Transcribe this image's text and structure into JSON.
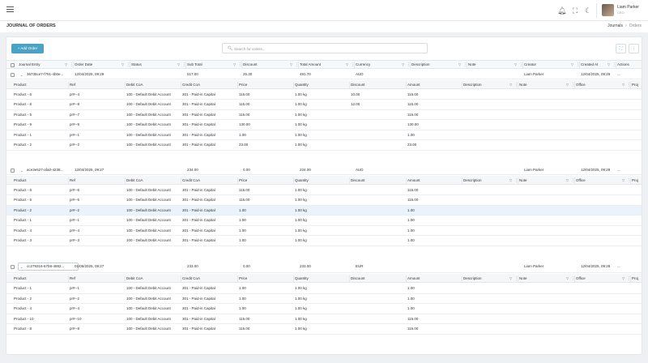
{
  "header": {
    "icons": [
      "menu-icon",
      "bell-icon",
      "fullscreen-icon",
      "moon-icon"
    ],
    "user": {
      "name": "Liam Parker",
      "role": "CEO"
    }
  },
  "page": {
    "title": "JOURNAL OF ORDERS",
    "breadcrumb": [
      "Journals",
      "Orders"
    ]
  },
  "toolbar": {
    "add_label": "+ Add Order",
    "search_placeholder": "Search for orders..."
  },
  "main_columns": [
    "Journal Entry",
    "Order Date",
    "Status",
    "Sub Total",
    "Discount",
    "Total Amount",
    "Currency",
    "Description",
    "Note",
    "Creator",
    "Created At",
    "Actions"
  ],
  "sub_columns": [
    "Product",
    "Ref",
    "Debit CoA",
    "Credit CoA",
    "Price",
    "Quantity",
    "Discount",
    "Amount",
    "Description",
    "Note",
    "Office",
    "Proj"
  ],
  "orders": [
    {
      "id": "36735ce7-f791-4b0e...",
      "date": "12/04/2025, 09:29",
      "status": "",
      "subtotal": "517.00",
      "discount": "25.30",
      "total": "491.70",
      "currency": "AUD",
      "description": "",
      "note": "",
      "creator": "Liam Parker",
      "created": "12/04/2025, 09:29",
      "actions": "...",
      "items": [
        {
          "product": "Product - 6",
          "ref": "pr#--4",
          "debit": "100 - Default Debit Account",
          "credit": "301 - Paid-in Capital",
          "price": "115.00",
          "qty": "1.00 kg",
          "discount": "10.00",
          "amount": "115.00"
        },
        {
          "product": "Product - 8",
          "ref": "pr#--8",
          "debit": "100 - Default Debit Account",
          "credit": "301 - Paid-in Capital",
          "price": "115.00",
          "qty": "1.00 kg",
          "discount": "12.00",
          "amount": "115.00"
        },
        {
          "product": "Product - 5",
          "ref": "pr#--7",
          "debit": "100 - Default Debit Account",
          "credit": "301 - Paid-in Capital",
          "price": "115.00",
          "qty": "1.00 kg",
          "discount": "",
          "amount": "115.00"
        },
        {
          "product": "Product - 9",
          "ref": "pr#--9",
          "debit": "100 - Default Debit Account",
          "credit": "301 - Paid-in Capital",
          "price": "130.00",
          "qty": "1.00 kg",
          "discount": "",
          "amount": "130.00"
        },
        {
          "product": "Product - 1",
          "ref": "pr#--1",
          "debit": "100 - Default Debit Account",
          "credit": "301 - Paid-in Capital",
          "price": "1.00",
          "qty": "1.00 kg",
          "discount": "",
          "amount": "1.00"
        },
        {
          "product": "Product - 2",
          "ref": "pr#--2",
          "debit": "100 - Default Debit Account",
          "credit": "301 - Paid-in Capital",
          "price": "23.00",
          "qty": "1.00 kg",
          "discount": "",
          "amount": "23.00"
        }
      ]
    },
    {
      "id": "ace3e527-afa0-4238...",
      "date": "12/04/2025, 09:27",
      "status": "",
      "subtotal": "234.00",
      "discount": "0.00",
      "total": "234.00",
      "currency": "AUD",
      "description": "",
      "note": "",
      "creator": "Liam Parker",
      "created": "12/04/2025, 09:28",
      "actions": "...",
      "items": [
        {
          "product": "Product - 6",
          "ref": "pr#--6",
          "debit": "100 - Default Debit Account",
          "credit": "301 - Paid-in Capital",
          "price": "115.00",
          "qty": "1.00 kg",
          "discount": "",
          "amount": "115.00"
        },
        {
          "product": "Product - 5",
          "ref": "pr#--5",
          "debit": "100 - Default Debit Account",
          "credit": "301 - Paid-in Capital",
          "price": "115.00",
          "qty": "1.00 kg",
          "discount": "",
          "amount": "115.00"
        },
        {
          "product": "Product - 2",
          "ref": "pr#--2",
          "debit": "100 - Default Debit Account",
          "credit": "301 - Paid-in Capital",
          "price": "1.00",
          "qty": "1.00 kg",
          "discount": "",
          "amount": "1.00"
        },
        {
          "product": "Product - 1",
          "ref": "pr#--1",
          "debit": "100 - Default Debit Account",
          "credit": "301 - Paid-in Capital",
          "price": "1.00",
          "qty": "1.00 kg",
          "discount": "",
          "amount": "1.00"
        },
        {
          "product": "Product - 4",
          "ref": "pr#--4",
          "debit": "100 - Default Debit Account",
          "credit": "301 - Paid-in Capital",
          "price": "1.00",
          "qty": "1.00 kg",
          "discount": "",
          "amount": "1.00"
        },
        {
          "product": "Product - 3",
          "ref": "pr#--3",
          "debit": "100 - Default Debit Account",
          "credit": "301 - Paid-in Capital",
          "price": "1.00",
          "qty": "1.00 kg",
          "discount": "",
          "amount": "1.00"
        }
      ]
    },
    {
      "id": "cc279316-67b8-4882...",
      "date": "01/06/2025, 09:27",
      "status": "",
      "subtotal": "233.00",
      "discount": "0.00",
      "total": "233.00",
      "currency": "EUR",
      "description": "",
      "note": "",
      "creator": "Liam Parker",
      "created": "12/04/2025, 09:28",
      "actions": "...",
      "items": [
        {
          "product": "Product - 1",
          "ref": "pr#--1",
          "debit": "100 - Default Debit Account",
          "credit": "301 - Paid-in Capital",
          "price": "1.00",
          "qty": "1.00 kg",
          "discount": "",
          "amount": "1.00"
        },
        {
          "product": "Product - 2",
          "ref": "pr#--2",
          "debit": "100 - Default Debit Account",
          "credit": "301 - Paid-in Capital",
          "price": "1.00",
          "qty": "1.00 kg",
          "discount": "",
          "amount": "1.00"
        },
        {
          "product": "Product - 4",
          "ref": "pr#--4",
          "debit": "100 - Default Debit Account",
          "credit": "301 - Paid-in Capital",
          "price": "1.00",
          "qty": "1.00 kg",
          "discount": "",
          "amount": "1.00"
        },
        {
          "product": "Product - 10",
          "ref": "pr#--10",
          "debit": "100 - Default Debit Account",
          "credit": "301 - Paid-in Capital",
          "price": "115.00",
          "qty": "1.00 kg",
          "discount": "",
          "amount": "115.00"
        },
        {
          "product": "Product - 8",
          "ref": "pr#--8",
          "debit": "100 - Default Debit Account",
          "credit": "301 - Paid-in Capital",
          "price": "115.00",
          "qty": "1.00 kg",
          "discount": "",
          "amount": "115.00"
        }
      ]
    }
  ]
}
